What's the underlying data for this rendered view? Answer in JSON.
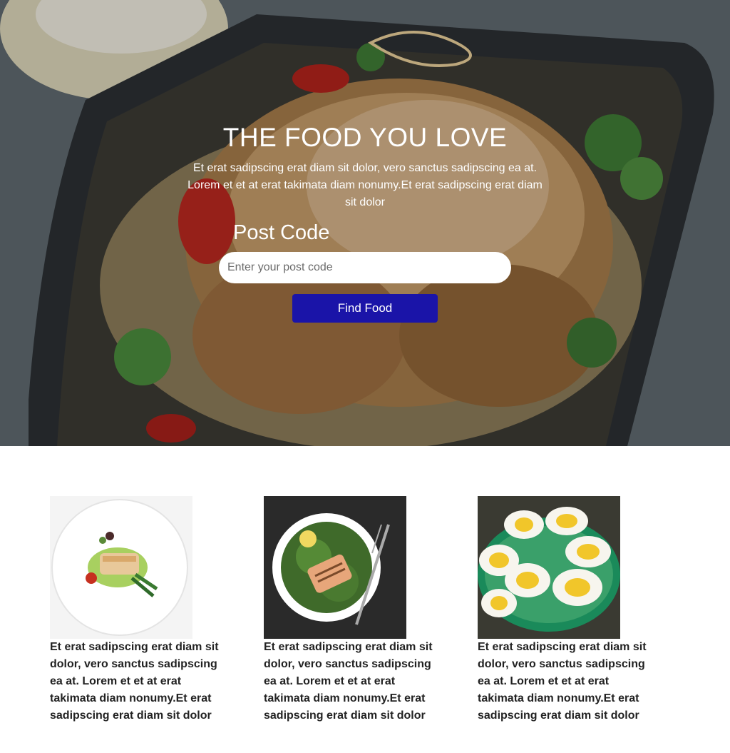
{
  "hero": {
    "title": "THE FOOD YOU LOVE",
    "text": "Et erat sadipscing erat diam sit dolor, vero sanctus sadipscing ea at. Lorem et et at erat takimata diam nonumy.Et erat sadipscing erat diam sit dolor",
    "postcode_label": "Post Code",
    "postcode_placeholder": "Enter your post code",
    "postcode_value": "",
    "button_label": "Find Food"
  },
  "cards": [
    {
      "image": "plated-fish-dish-image",
      "text": "Et erat sadipscing erat diam sit dolor, vero sanctus sadipscing ea at. Lorem et et at erat takimata diam nonumy.Et erat sadipscing erat diam sit dolor"
    },
    {
      "image": "grilled-salmon-greens-image",
      "text": "Et erat sadipscing erat diam sit dolor, vero sanctus sadipscing ea at. Lorem et et at erat takimata diam nonumy.Et erat sadipscing erat diam sit dolor"
    },
    {
      "image": "deviled-eggs-image",
      "text": "Et erat sadipscing erat diam sit dolor, vero sanctus sadipscing ea at. Lorem et et at erat takimata diam nonumy.Et erat sadipscing erat diam sit dolor"
    }
  ],
  "colors": {
    "button_bg": "#1a14a8",
    "hero_text": "#ffffff",
    "card_text": "#222222"
  }
}
